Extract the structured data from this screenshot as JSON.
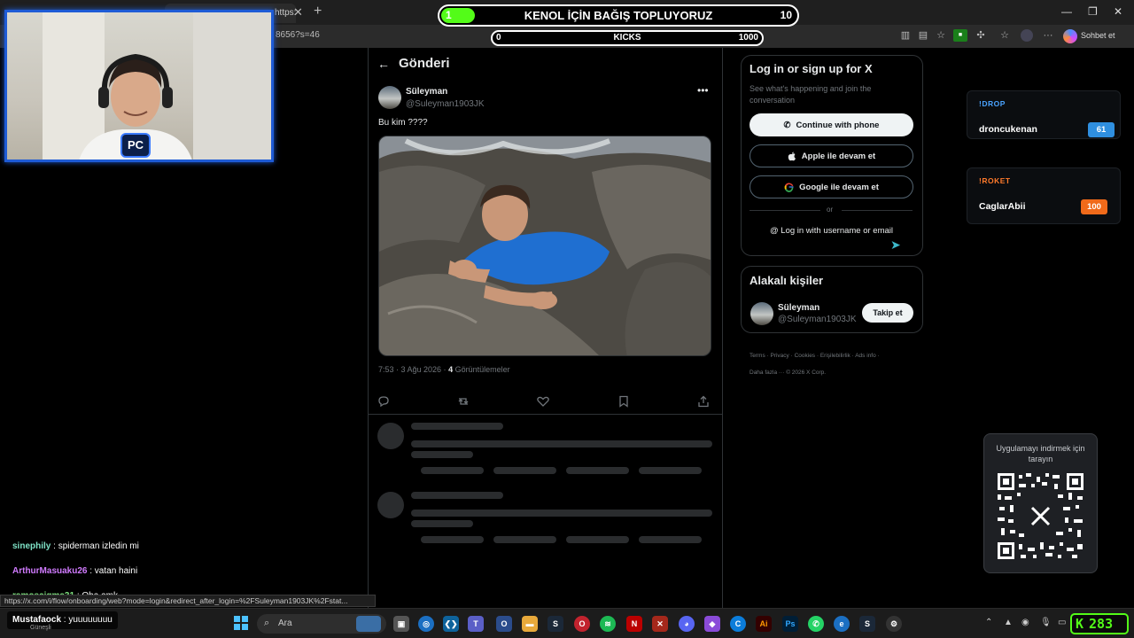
{
  "browser": {
    "tab_fragment": "https:",
    "address_fragment": "8656?s=46",
    "copilot_label": "Sohbet et"
  },
  "overlay": {
    "goal1": {
      "current": "1",
      "title": "KENOL İÇİN BAĞIŞ TOPLUYORUZ",
      "max": "10",
      "progress_fraction": 0.1
    },
    "goal2": {
      "current": "0",
      "title": "KICKS",
      "max": "1000",
      "progress_fraction": 0.0
    }
  },
  "post": {
    "header_title": "Gönderi",
    "author_name": "Süleyman",
    "author_handle": "@Suleyman1903JK",
    "text": "Bu kim ????",
    "time": "7:53 · 3 Ağu 2026 ·",
    "views_count": "4",
    "views_label": "Görüntülemeler"
  },
  "sidebar": {
    "login": {
      "title": "Log in or sign up for X",
      "subtitle": "See what's happening and join the conversation",
      "phone": "Continue with phone",
      "apple": "Apple ile devam et",
      "google": "Google ile devam et",
      "or": "or",
      "username": "Log in with username or email"
    },
    "related": {
      "title": "Alakalı kişiler",
      "name": "Süleyman",
      "handle": "@Suleyman1903JK",
      "follow": "Takip et"
    },
    "footer": {
      "terms": "Terms",
      "privacy": "Privacy",
      "cookies": "Cookies",
      "accessibility": "Erişilebilirlik",
      "ads": "Ads info",
      "more": "Daha fazla ···",
      "copyright": "© 2026 X Corp."
    }
  },
  "widgets": {
    "drop": {
      "tag": "!DROP",
      "user": "droncukenan",
      "value": "61",
      "tag_color": "#4aa3ff",
      "badge_color": "#2f8fe0"
    },
    "roket": {
      "tag": "!ROKET",
      "user": "CaglarAbii",
      "value": "100",
      "tag_color": "#ff7a2b",
      "badge_color": "#f06a1a"
    }
  },
  "qr": {
    "text": "Uygulamayı indirmek için tarayın"
  },
  "chat": [
    {
      "user": "sinephily",
      "message": ": spiderman izledin mi",
      "color": "#7fe3c7"
    },
    {
      "user": "ArthurMasuaku26",
      "message": ": vatan haini",
      "color": "#d17bff"
    },
    {
      "user": "ramoscigma31",
      "message": ": Oha amk",
      "color": "#7fe37f"
    },
    {
      "user": "Mustafaock",
      "message": ": yuuuuuuuu",
      "color": "#ffffff"
    }
  ],
  "status_url": "https://x.com/i/flow/onboarding/web?mode=login&redirect_after_login=%2FSuleyman1903JK%2Fstat...",
  "taskbar": {
    "weather": "Güneşli",
    "search": "Ara",
    "kick_counter": "283"
  }
}
